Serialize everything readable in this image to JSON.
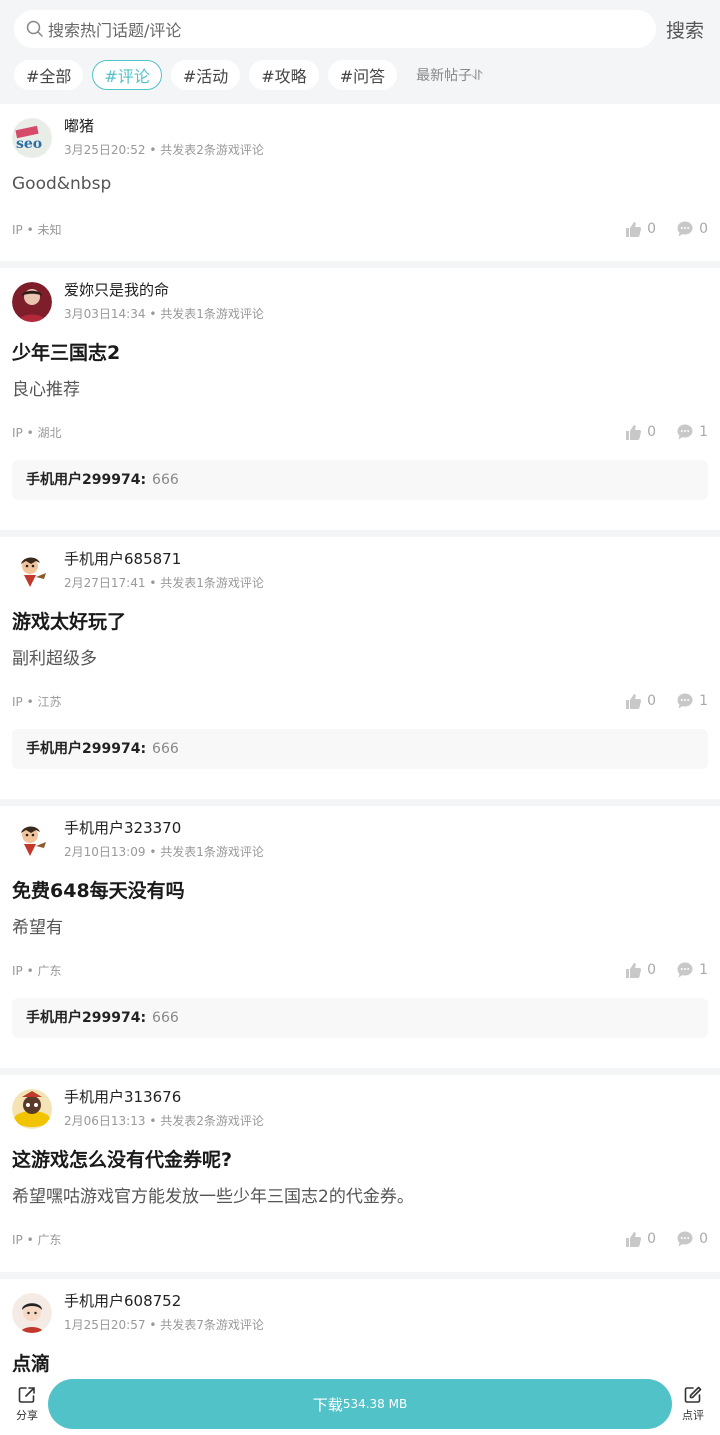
{
  "search": {
    "placeholder": "搜索热门话题/评论",
    "button_label": "搜索"
  },
  "tags": [
    {
      "label": "#全部",
      "active": false
    },
    {
      "label": "#评论",
      "active": true
    },
    {
      "label": "#活动",
      "active": false
    },
    {
      "label": "#攻略",
      "active": false
    },
    {
      "label": "#问答",
      "active": false
    }
  ],
  "sort_label": "最新帖子⥯",
  "posts": [
    {
      "username": "嘟猪",
      "time": "3月25日20:52",
      "count_text": "共发表2条游戏评论",
      "title": "",
      "body": "Good&nbsp",
      "ip": "IP • 未知",
      "likes": "0",
      "comments": "0",
      "reply": null
    },
    {
      "username": "爱妳只是我的命",
      "time": "3月03日14:34",
      "count_text": "共发表1条游戏评论",
      "title": "少年三国志2",
      "body": "良心推荐",
      "ip": "IP • 湖北",
      "likes": "0",
      "comments": "1",
      "reply": {
        "user": "手机用户299974:",
        "text": "666"
      }
    },
    {
      "username": "手机用户685871",
      "time": "2月27日17:41",
      "count_text": "共发表1条游戏评论",
      "title": "游戏太好玩了",
      "body": "副利超级多",
      "ip": "IP • 江苏",
      "likes": "0",
      "comments": "1",
      "reply": {
        "user": "手机用户299974:",
        "text": "666"
      }
    },
    {
      "username": "手机用户323370",
      "time": "2月10日13:09",
      "count_text": "共发表1条游戏评论",
      "title": "免费648每天没有吗",
      "body": "希望有",
      "ip": "IP • 广东",
      "likes": "0",
      "comments": "1",
      "reply": {
        "user": "手机用户299974:",
        "text": "666"
      }
    },
    {
      "username": "手机用户313676",
      "time": "2月06日13:13",
      "count_text": "共发表2条游戏评论",
      "title": "这游戏怎么没有代金券呢?",
      "body": "希望嘿咕游戏官方能发放一些少年三国志2的代金券。",
      "ip": "IP • 广东",
      "likes": "0",
      "comments": "0",
      "reply": null
    },
    {
      "username": "手机用户608752",
      "time": "1月25日20:57",
      "count_text": "共发表7条游戏评论",
      "title": "点滴",
      "body": "",
      "ip": "",
      "likes": "",
      "comments": "",
      "reply": null
    }
  ],
  "bottom": {
    "share_label": "分享",
    "download_label": "下载",
    "download_size": "534.38 MB",
    "review_label": "点评"
  },
  "colors": {
    "accent": "#52c2c9"
  }
}
